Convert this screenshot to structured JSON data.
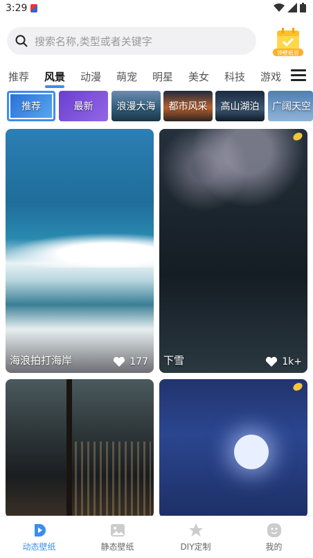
{
  "status_bar": {
    "time": "3:29"
  },
  "search": {
    "placeholder": "搜索名称,类型或者关键字"
  },
  "vip_badge": {
    "label": "领壁纸豆"
  },
  "tabs": [
    "推荐",
    "风景",
    "动漫",
    "萌宠",
    "明星",
    "美女",
    "科技",
    "游戏"
  ],
  "active_tab": "风景",
  "chips": [
    "推荐",
    "最新",
    "浪漫大海",
    "都市风采",
    "高山湖泊",
    "广阔天空"
  ],
  "cards": [
    {
      "title": "海浪拍打海岸",
      "likes": "177"
    },
    {
      "title": "下雪",
      "likes": "1k+"
    },
    {
      "title": "",
      "likes": ""
    },
    {
      "title": "",
      "likes": ""
    }
  ],
  "bottom_nav": [
    {
      "label": "动态壁纸"
    },
    {
      "label": "静态壁纸"
    },
    {
      "label": "DIY定制"
    },
    {
      "label": "我的"
    }
  ],
  "colors": {
    "accent": "#3a8ef0",
    "chip_purple": "#7b4fd6"
  }
}
